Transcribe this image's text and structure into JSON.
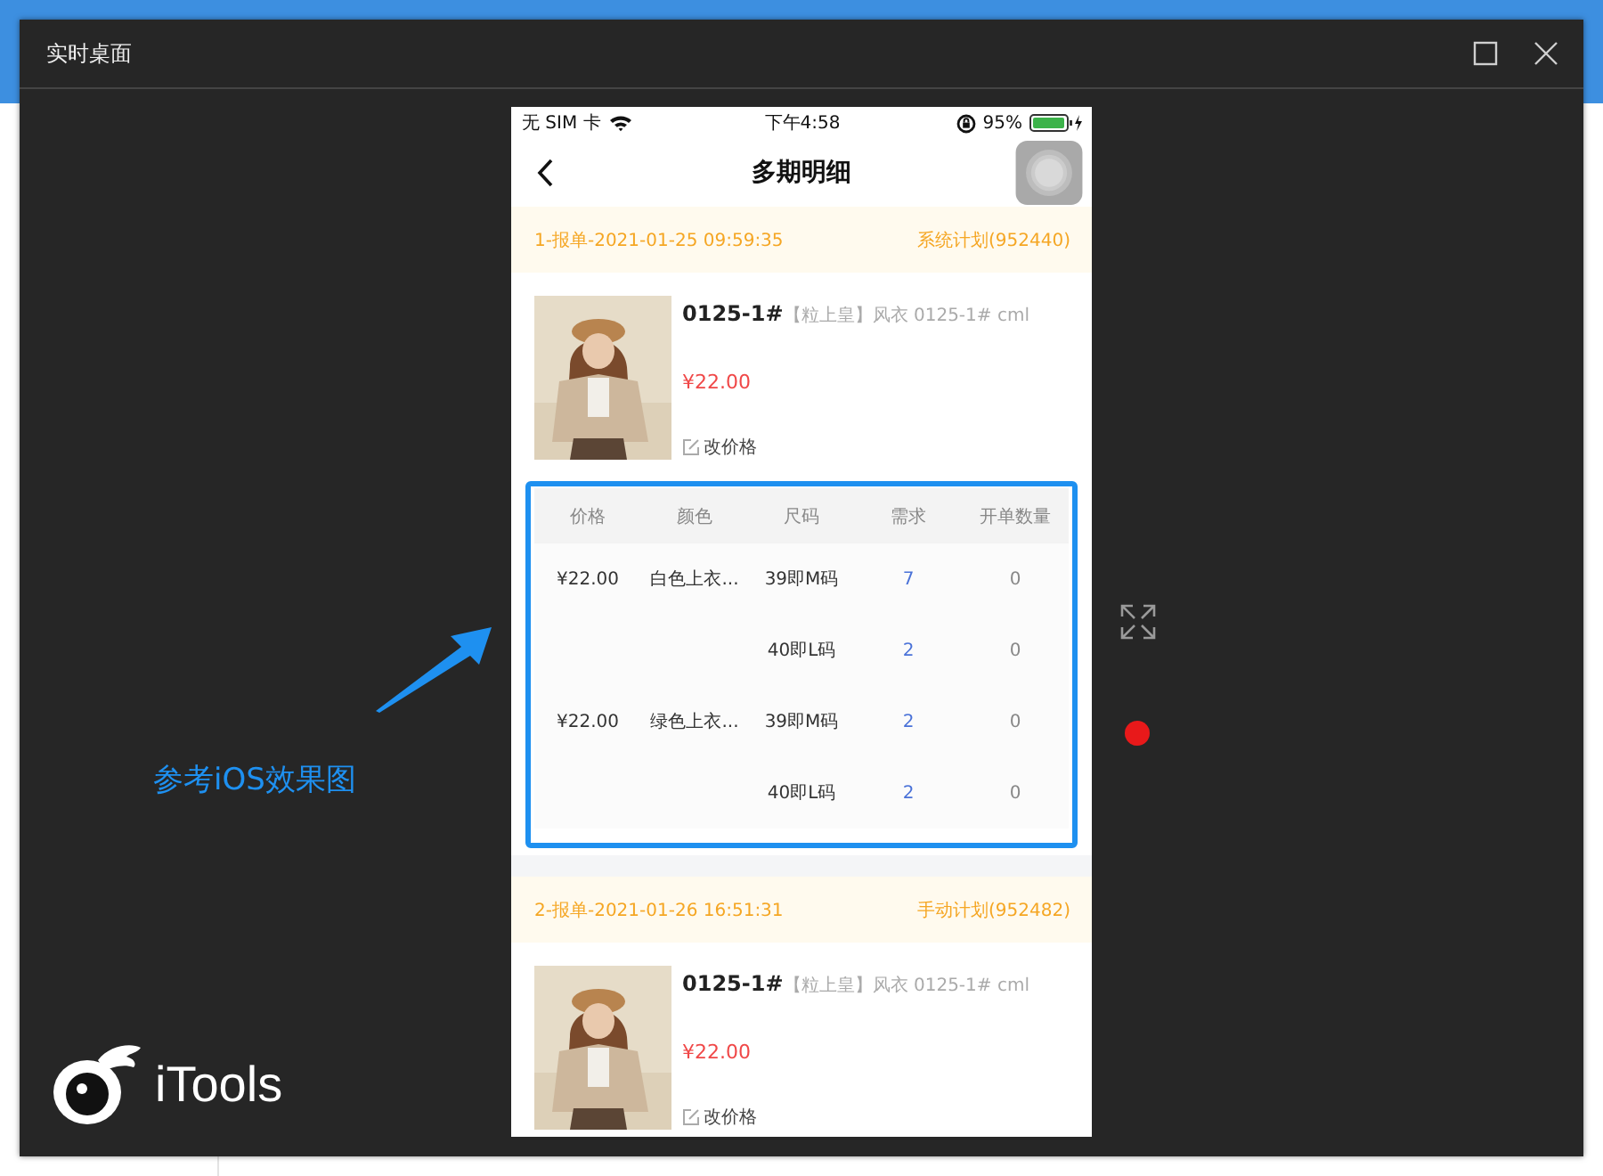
{
  "window": {
    "title": "实时桌面"
  },
  "phone": {
    "status_bar": {
      "carrier": "无 SIM 卡",
      "time": "下午4:58",
      "battery": "95%"
    },
    "nav": {
      "title": "多期明细"
    },
    "orders": [
      {
        "header_left": "1-报单-2021-01-25 09:59:35",
        "header_right": "系统计划(952440)",
        "product": {
          "code": "0125-1#",
          "name": "【粒上皇】风衣  0125-1#  cml",
          "price": "¥22.00",
          "edit_label": "改价格"
        },
        "table": {
          "columns": [
            "价格",
            "颜色",
            "尺码",
            "需求",
            "开单数量"
          ],
          "rows": [
            {
              "price": "¥22.00",
              "variant": "白色上衣...",
              "size": "39即M码",
              "demand": "7",
              "count": "0"
            },
            {
              "size": "40即L码",
              "demand": "2",
              "count": "0"
            },
            {
              "price": "¥22.00",
              "variant": "绿色上衣...",
              "size": "39即M码",
              "demand": "2",
              "count": "0"
            },
            {
              "size": "40即L码",
              "demand": "2",
              "count": "0"
            }
          ]
        }
      },
      {
        "header_left": "2-报单-2021-01-26 16:51:31",
        "header_right": "手动计划(952482)",
        "product": {
          "code": "0125-1#",
          "name": "【粒上皇】风衣  0125-1#  cml",
          "price": "¥22.00",
          "edit_label": "改价格"
        }
      }
    ]
  },
  "annotation": {
    "label": "参考iOS效果图"
  },
  "logo": {
    "text": "iTools"
  }
}
